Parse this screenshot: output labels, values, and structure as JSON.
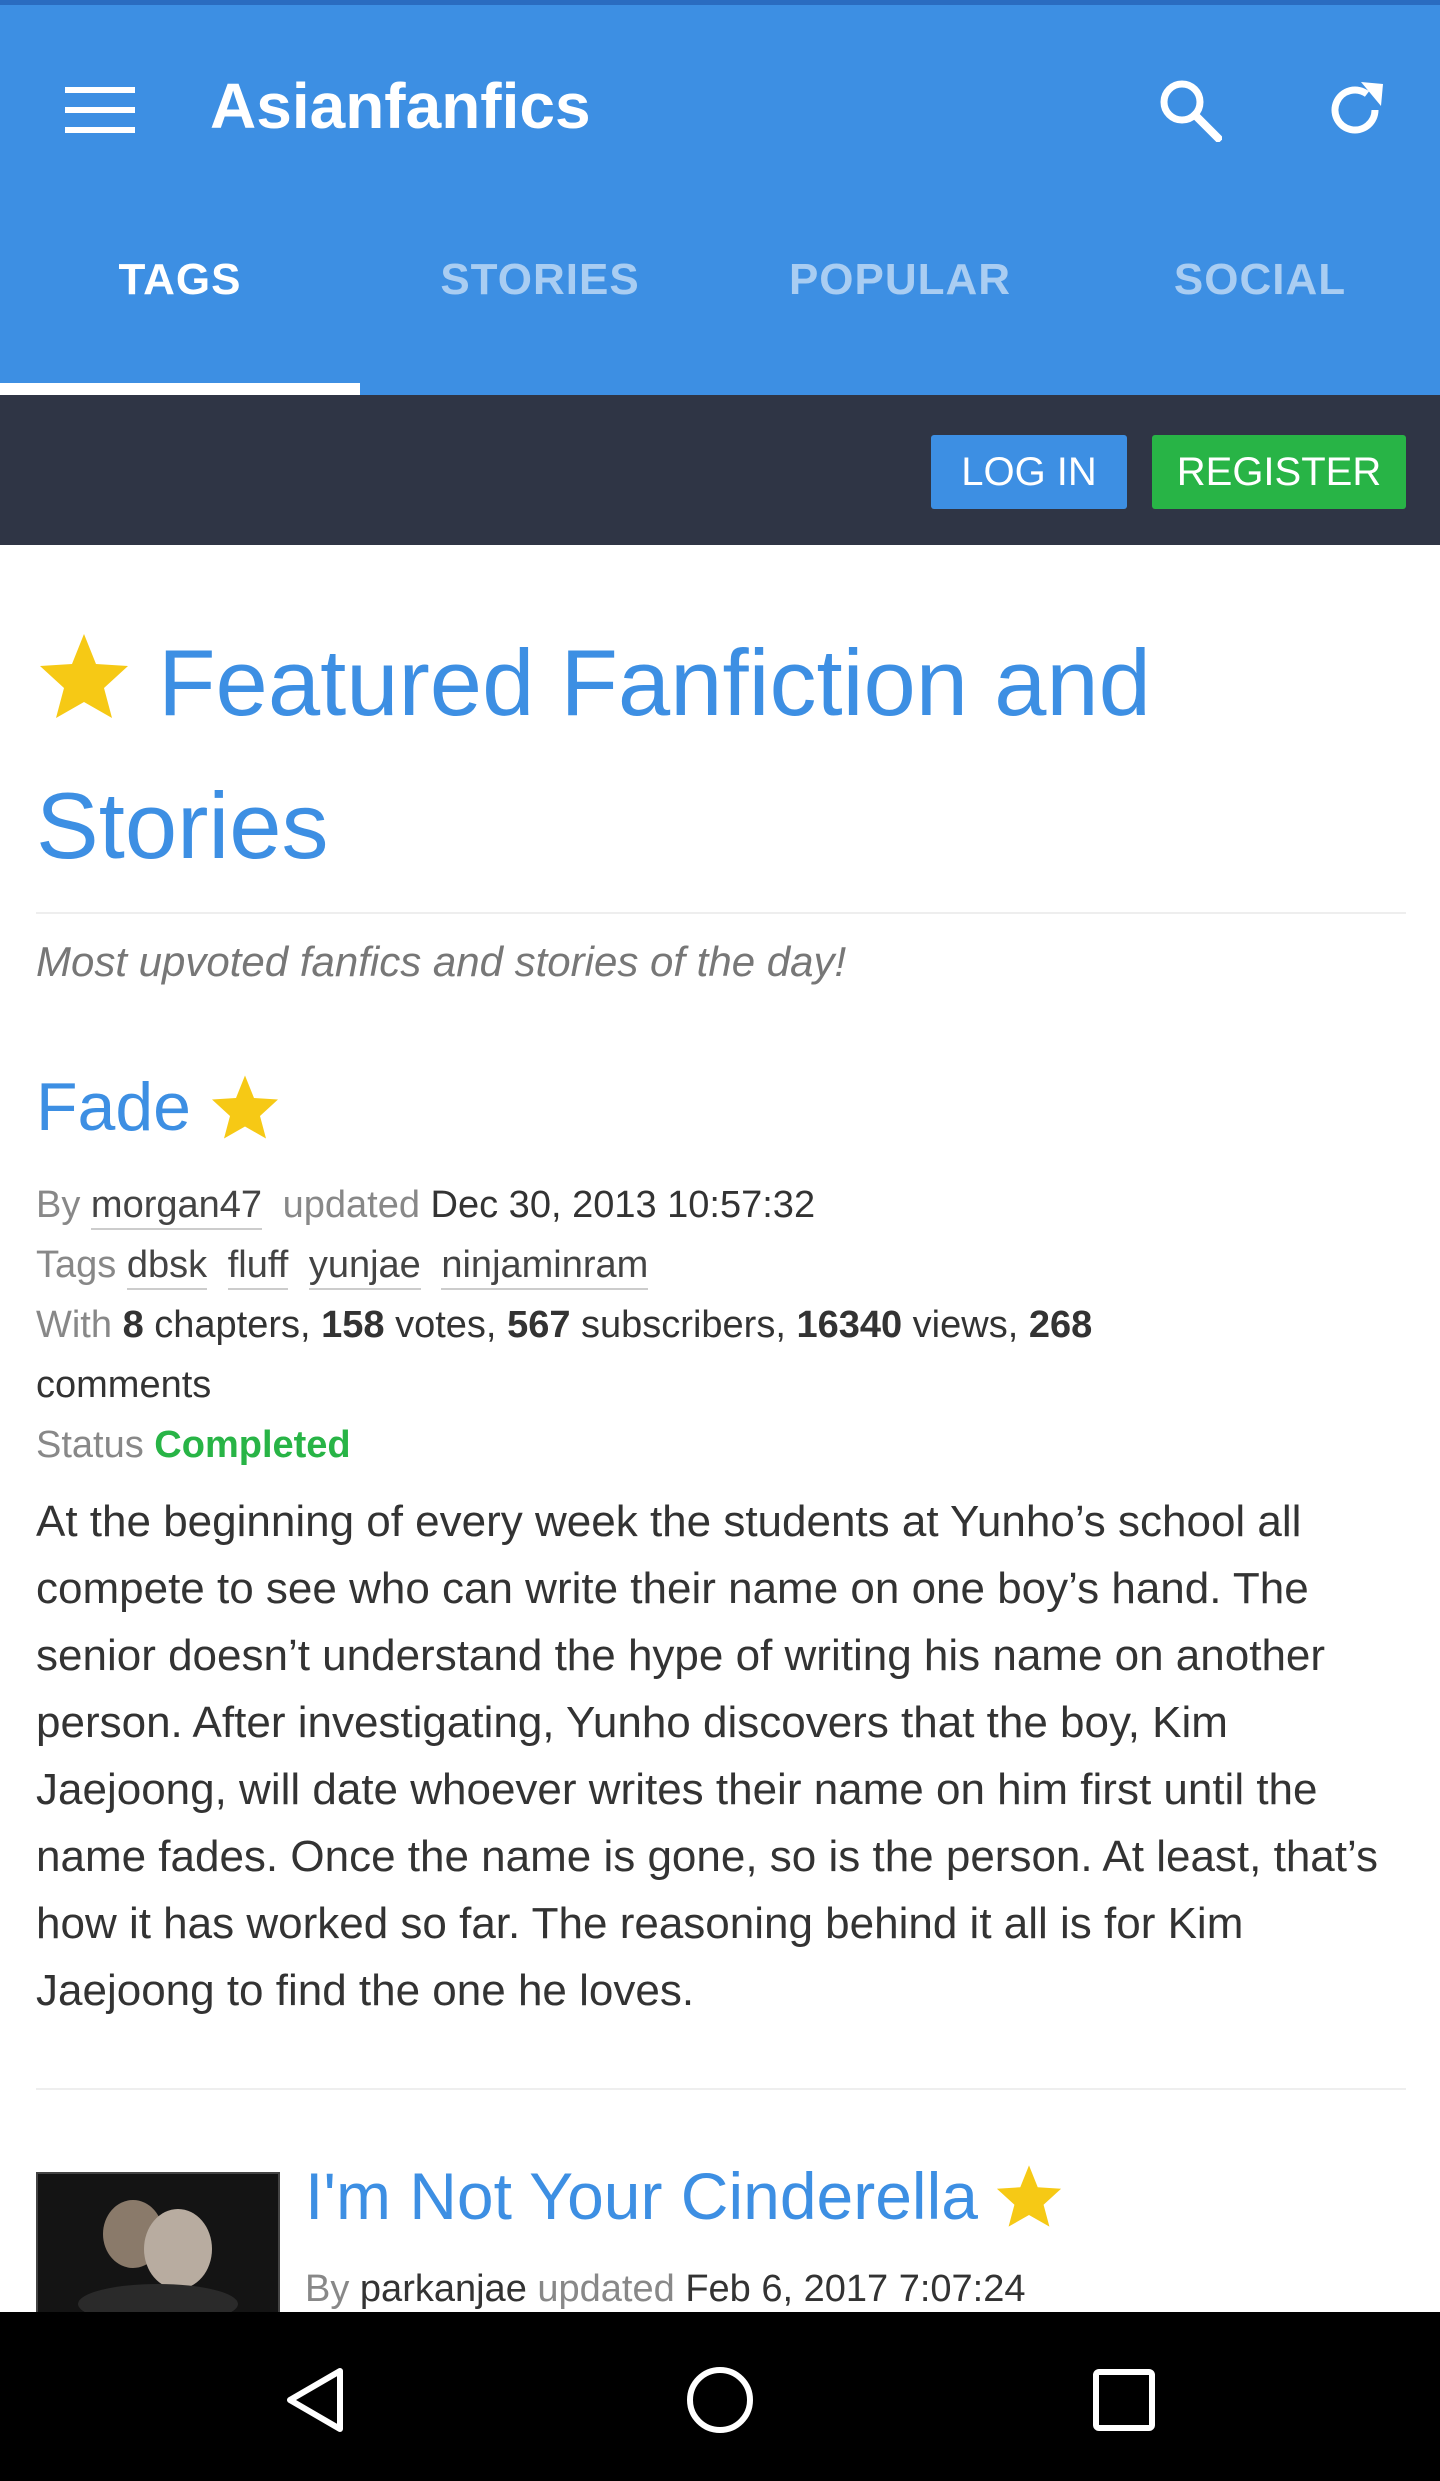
{
  "appbar": {
    "title": "Asianfanfics",
    "icons": {
      "menu": "menu-icon",
      "search": "search-icon",
      "refresh": "refresh-icon"
    },
    "colors": {
      "primary": "#3d8fe3",
      "dark": "#2f3545",
      "success": "#28b446"
    }
  },
  "tabs": [
    {
      "label": "TAGS",
      "active": true
    },
    {
      "label": "STORIES",
      "active": false
    },
    {
      "label": "POPULAR",
      "active": false
    },
    {
      "label": "SOCIAL",
      "active": false
    }
  ],
  "auth": {
    "login_label": "LOG IN",
    "register_label": "REGISTER"
  },
  "featured": {
    "title_line1": "Featured Fanfiction and",
    "title_line2": "Stories",
    "subtitle": "Most upvoted fanfics and stories of the day!"
  },
  "story1": {
    "title": "Fade",
    "by_label": "By",
    "author": "morgan47",
    "updated_label": "updated",
    "updated": "Dec 30, 2013 10:57:32",
    "tags_label": "Tags",
    "tags": [
      "dbsk",
      "fluff",
      "yunjae",
      "ninjaminram"
    ],
    "with_label": "With",
    "chapters": "8",
    "chapters_label": "chapters,",
    "votes": "158",
    "votes_label": "votes,",
    "subscribers": "567",
    "subscribers_label": "subscribers,",
    "views": "16340",
    "views_label": "views,",
    "comments": "268",
    "comments_label": "comments",
    "status_label": "Status",
    "status": "Completed",
    "description": "At the beginning of every week the students at Yunho’s school all compete to see who can write their name on one boy’s hand. The senior doesn’t understand the hype of writing his name on another person. After investigating, Yunho discovers that the boy, Kim Jaejoong, will date whoever writes their name on him first until the name fades. Once the name is gone, so is the person. At least, that’s how it has worked so far. The reasoning behind it all is for Kim Jaejoong to find the one he loves."
  },
  "story2": {
    "title": "I'm Not Your Cinderella",
    "by_label": "By",
    "author": "parkanjae",
    "updated_label": "updated",
    "updated": "Feb 6, 2017 7:07:24"
  },
  "navbar": {
    "back": "back-icon",
    "home": "home-icon",
    "recents": "recents-icon"
  }
}
